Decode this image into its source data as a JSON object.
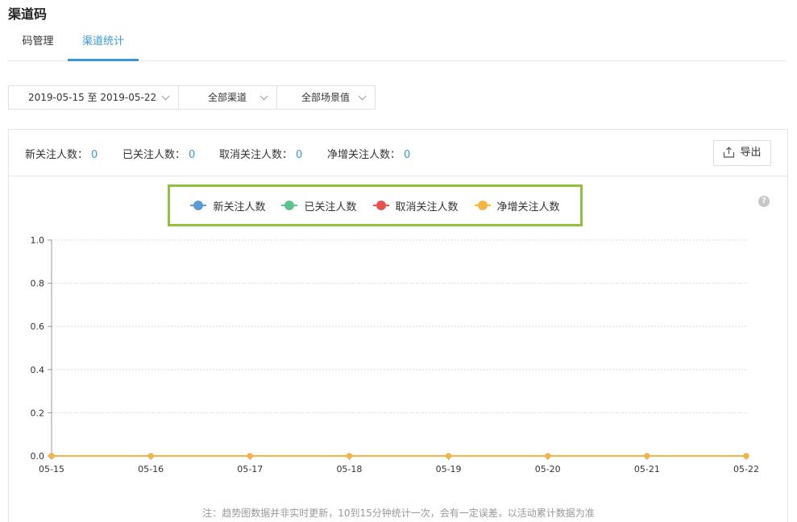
{
  "page_title": "渠道码",
  "tabs": [
    {
      "label": "码管理",
      "active": false
    },
    {
      "label": "渠道统计",
      "active": true
    }
  ],
  "filters": {
    "date_range": "2019-05-15 至 2019-05-22",
    "channel": "全部渠道",
    "scene": "全部场景值"
  },
  "stats": [
    {
      "label": "新关注人数：",
      "value": "0"
    },
    {
      "label": "已关注人数：",
      "value": "0"
    },
    {
      "label": "取消关注人数：",
      "value": "0"
    },
    {
      "label": "净增关注人数：",
      "value": "0"
    }
  ],
  "export_label": "导出",
  "legend": [
    {
      "name": "新关注人数",
      "color": "#5b9bd5"
    },
    {
      "name": "已关注人数",
      "color": "#5cc48a"
    },
    {
      "name": "取消关注人数",
      "color": "#e8504f"
    },
    {
      "name": "净增关注人数",
      "color": "#f5b540"
    }
  ],
  "help_icon": "question-circle-icon",
  "chart_data": {
    "type": "line",
    "x": [
      "05-15",
      "05-16",
      "05-17",
      "05-18",
      "05-19",
      "05-20",
      "05-21",
      "05-22"
    ],
    "y_ticks": [
      "0.0",
      "0.2",
      "0.4",
      "0.6",
      "0.8",
      "1.0"
    ],
    "ylim": [
      0,
      1
    ],
    "grid": true,
    "legend_position": "top",
    "series": [
      {
        "name": "新关注人数",
        "color": "#5b9bd5",
        "values": [
          0,
          0,
          0,
          0,
          0,
          0,
          0,
          0
        ]
      },
      {
        "name": "已关注人数",
        "color": "#5cc48a",
        "values": [
          0,
          0,
          0,
          0,
          0,
          0,
          0,
          0
        ]
      },
      {
        "name": "取消关注人数",
        "color": "#e8504f",
        "values": [
          0,
          0,
          0,
          0,
          0,
          0,
          0,
          0
        ]
      },
      {
        "name": "净增关注人数",
        "color": "#f5b540",
        "values": [
          0,
          0,
          0,
          0,
          0,
          0,
          0,
          0
        ]
      }
    ]
  },
  "note": "注：趋势图数据并非实时更新，10到15分钟统计一次，会有一定误差，以活动累计数据为准"
}
